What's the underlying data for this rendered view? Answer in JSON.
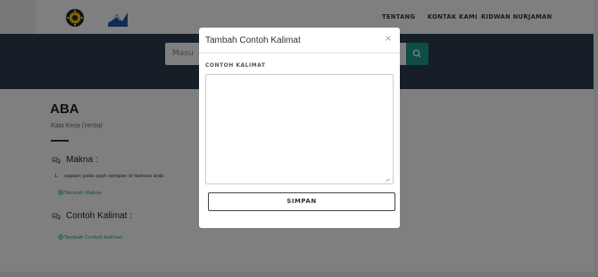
{
  "navbar": {
    "logos": [
      "university-seal",
      "dictionary-logo"
    ],
    "links": [
      "TENTANG",
      "KONTAK KAMI",
      "RIDWAN NURJAMAN"
    ]
  },
  "search": {
    "placeholder": "Masu",
    "button_icon": "search-icon"
  },
  "entry": {
    "word": "ABA",
    "part_of_speech": "Kata Kerja (Verba)",
    "meaning_heading": "Makna :",
    "meanings": [
      {
        "number": "1.",
        "text": "sapaan pada ayah serapan dr bahasa arab"
      }
    ],
    "add_meaning": "Tambah Makna",
    "example_heading": "Contoh Kalimat :",
    "add_example": "Tambah Contoh Kalimat"
  },
  "modal": {
    "title": "Tambah Contoh Kalimat",
    "close": "×",
    "field_label": "CONTOH KALIMAT",
    "field_value": "",
    "submit": "SIMPAN"
  },
  "colors": {
    "hero_bg": "#2c3e50",
    "accent": "#1a9c8a",
    "link_green": "#2a9d6e",
    "backdrop": "rgba(0,0,0,0.5)"
  }
}
